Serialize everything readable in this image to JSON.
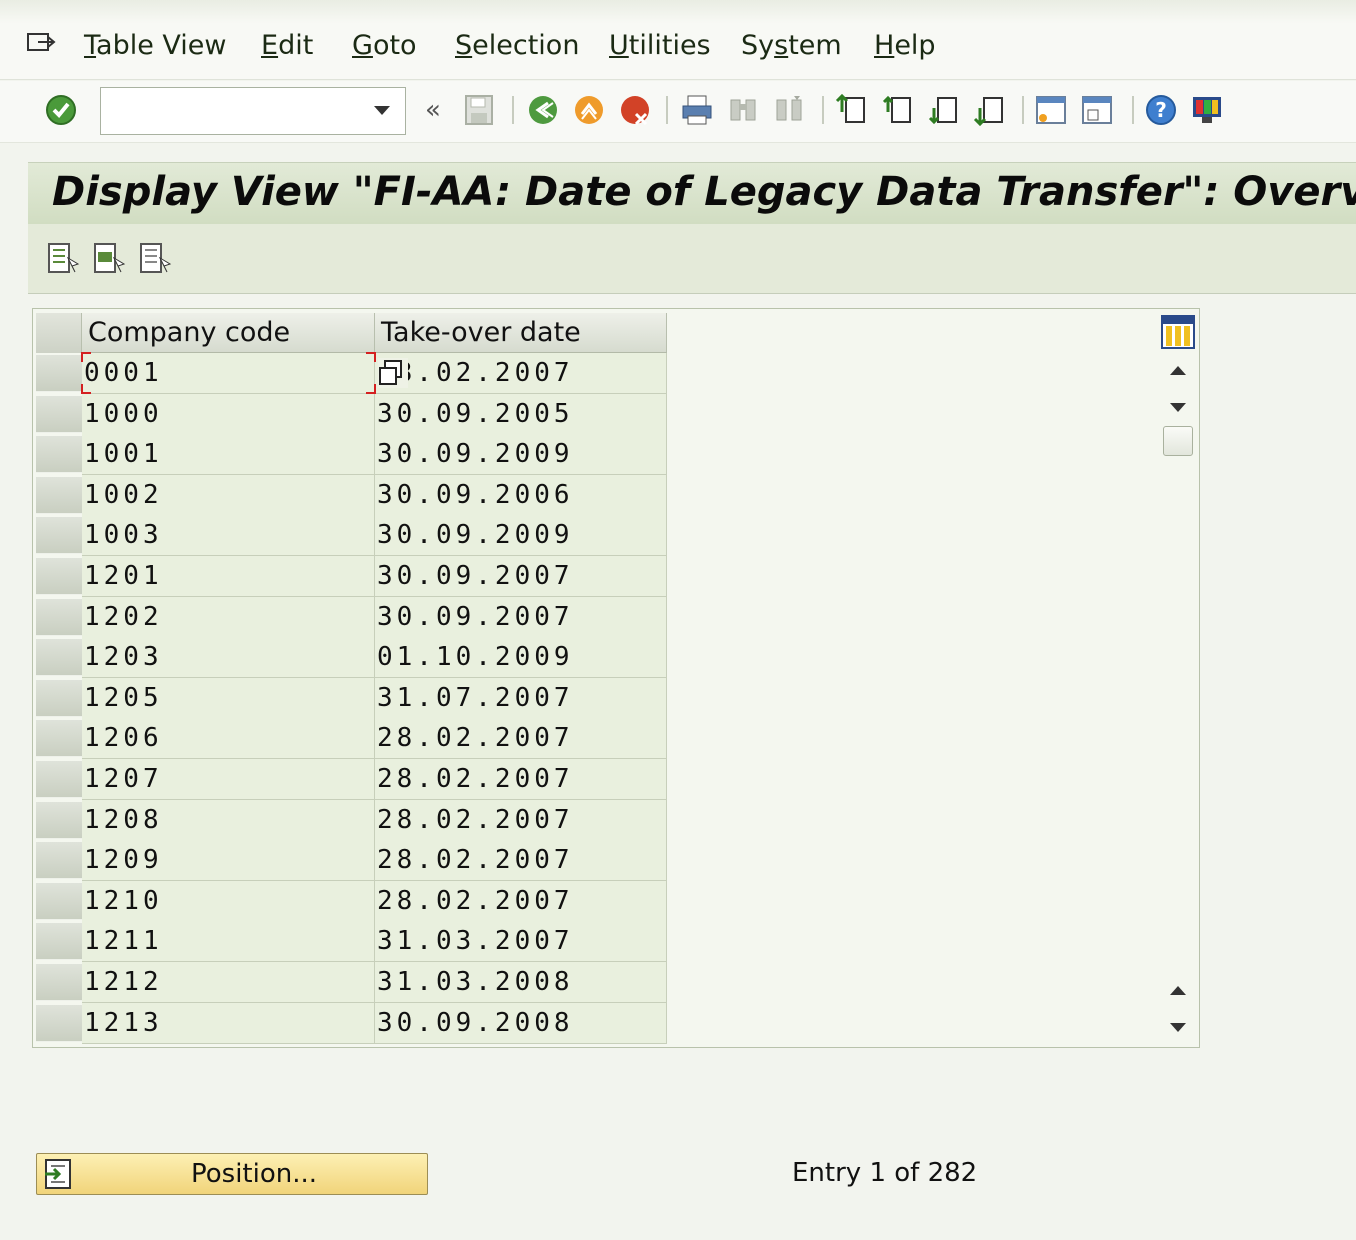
{
  "menu": {
    "items": [
      {
        "prefix": "",
        "u": "T",
        "rest": "able View"
      },
      {
        "prefix": "",
        "u": "E",
        "rest": "dit"
      },
      {
        "prefix": "",
        "u": "G",
        "rest": "oto"
      },
      {
        "prefix": "",
        "u": "S",
        "rest": "election"
      },
      {
        "prefix": "",
        "u": "U",
        "rest": "tilities"
      },
      {
        "prefix": "Sy",
        "u": "s",
        "rest": "tem"
      },
      {
        "prefix": "",
        "u": "H",
        "rest": "elp"
      }
    ]
  },
  "toolbar": {
    "command_value": "",
    "back_double": "«"
  },
  "title": "Display View \"FI-AA: Date of Legacy Data Transfer\": Overview",
  "table": {
    "columns": [
      "Company code",
      "Take-over date"
    ],
    "rows": [
      [
        "0001",
        "28.02.2007"
      ],
      [
        "1000",
        "30.09.2005"
      ],
      [
        "1001",
        "30.09.2009"
      ],
      [
        "1002",
        "30.09.2006"
      ],
      [
        "1003",
        "30.09.2009"
      ],
      [
        "1201",
        "30.09.2007"
      ],
      [
        "1202",
        "30.09.2007"
      ],
      [
        "1203",
        "01.10.2009"
      ],
      [
        "1205",
        "31.07.2007"
      ],
      [
        "1206",
        "28.02.2007"
      ],
      [
        "1207",
        "28.02.2007"
      ],
      [
        "1208",
        "28.02.2007"
      ],
      [
        "1209",
        "28.02.2007"
      ],
      [
        "1210",
        "28.02.2007"
      ],
      [
        "1211",
        "31.03.2007"
      ],
      [
        "1212",
        "31.03.2008"
      ],
      [
        "1213",
        "30.09.2008"
      ]
    ]
  },
  "footer": {
    "position_label": "Position...",
    "entry_text": "Entry 1 of 282"
  },
  "colors": {
    "title_bg": "#d7e1c9",
    "row_bg": "#e9f0de",
    "position_button": "#f6dd8c"
  }
}
